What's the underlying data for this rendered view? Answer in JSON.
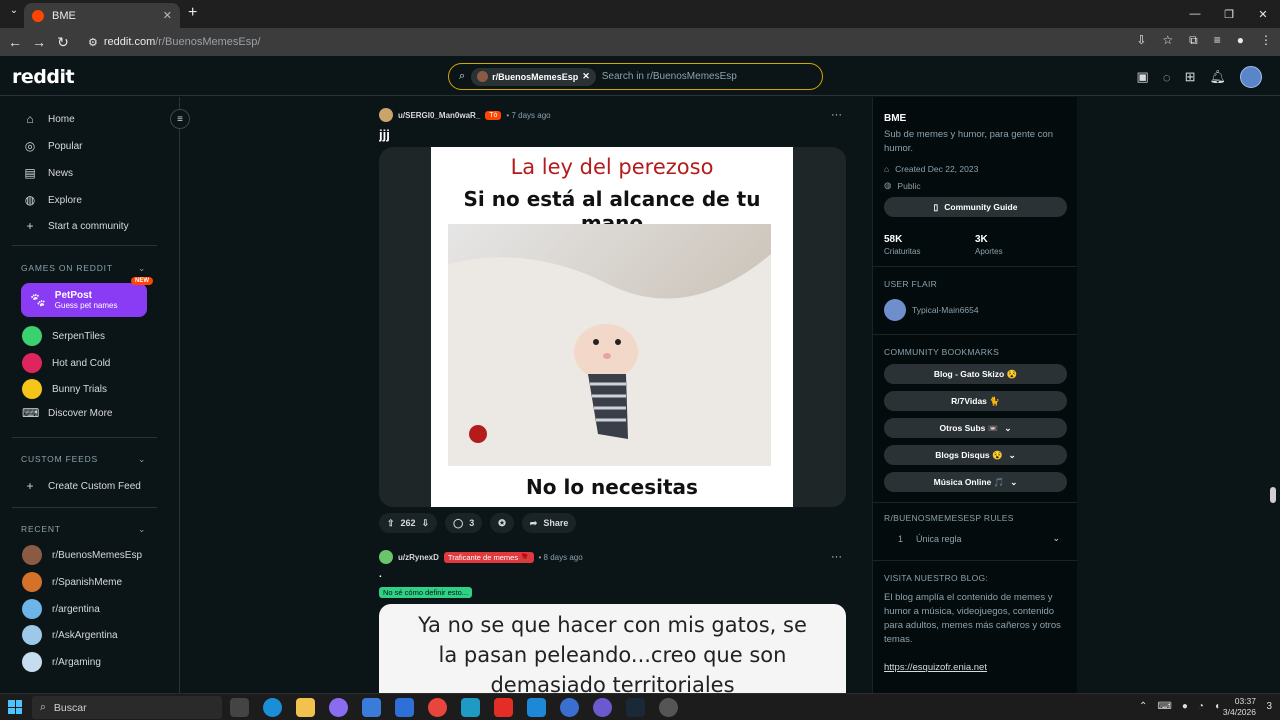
{
  "browser": {
    "tab_title": "BME",
    "url_host": "reddit.com",
    "url_path": "/r/BuenosMemesEsp/"
  },
  "header": {
    "logo": "reddit",
    "search_chip": "r/BuenosMemesEsp",
    "search_placeholder": "Search in r/BuenosMemesEsp"
  },
  "sidebar": {
    "nav": [
      {
        "label": "Home",
        "icon": "home-icon"
      },
      {
        "label": "Popular",
        "icon": "popular-icon"
      },
      {
        "label": "News",
        "icon": "news-icon"
      },
      {
        "label": "Explore",
        "icon": "explore-icon"
      },
      {
        "label": "Start a community",
        "icon": "plus-icon"
      }
    ],
    "games_title": "GAMES ON REDDIT",
    "petpost": {
      "title": "PetPost",
      "subtitle": "Guess pet names",
      "badge": "NEW"
    },
    "games": [
      {
        "label": "SerpenTiles",
        "color": "#3bd16f"
      },
      {
        "label": "Hot and Cold",
        "color": "#e0245e"
      },
      {
        "label": "Bunny Trials",
        "color": "#f5c518"
      },
      {
        "label": "Discover More",
        "color": "#0b1416"
      }
    ],
    "custom_title": "CUSTOM FEEDS",
    "custom_item": "Create Custom Feed",
    "recent_title": "RECENT",
    "recent": [
      {
        "label": "r/BuenosMemesEsp",
        "color": "#8a5a44"
      },
      {
        "label": "r/SpanishMeme",
        "color": "#d4722a"
      },
      {
        "label": "r/argentina",
        "color": "#6fb4e6"
      },
      {
        "label": "r/AskArgentina",
        "color": "#9ec8ea"
      },
      {
        "label": "r/Argaming",
        "color": "#c8dcef"
      }
    ]
  },
  "post1": {
    "user": "u/SERGI0_Man0waR_",
    "flair": "Tó",
    "time": "• 7 days ago",
    "title": "jjj",
    "meme_line1": "La ley del perezoso",
    "meme_line2": "Si no está al alcance de tu mano",
    "meme_line3": "No lo necesitas",
    "votes": "262",
    "comments": "3",
    "share": "Share"
  },
  "post2": {
    "user": "u/zRynexD",
    "flair": "Traficante de memes 🌹",
    "time": "• 8 days ago",
    "title": ".",
    "tag": "No sé cómo definir esto...",
    "meme_text1": "Ya no se que hacer con mis gatos, se",
    "meme_text2": "la pasan peleando...creo que son",
    "meme_text3": "demasiado territoriales"
  },
  "community": {
    "name": "BME",
    "description": "Sub de memes y humor, para gente con humor.",
    "created": "Created Dec 22, 2023",
    "visibility": "Public",
    "guide_button": "Community Guide",
    "members_count": "58K",
    "members_label": "Criaturitas",
    "online_count": "3K",
    "online_label": "Aportes",
    "user_flair_title": "USER FLAIR",
    "user_flair_name": "Typical-Main6654",
    "bookmarks_title": "COMMUNITY BOOKMARKS",
    "bookmarks": [
      "Blog - Gato Skizo 😵",
      "R/7Vidas 🐈",
      "Otros Subs 📼",
      "Blogs Disqus 😵",
      "Música Online 🎵"
    ],
    "rules_title": "R/BUENOSMEMESESP RULES",
    "rule_num": "1",
    "rule_text": "Única regla",
    "blog_title": "VISITA NUESTRO BLOG:",
    "blog_text": "El blog amplía el contenido de memes y humor a música, videojuegos, contenido para adultos, memes más cañeros y otros temas.",
    "blog_link": "https://esquizofr.enia.net"
  },
  "taskbar": {
    "search": "Buscar",
    "time": "03:37",
    "date": "3/4/2026",
    "notif": "3"
  }
}
